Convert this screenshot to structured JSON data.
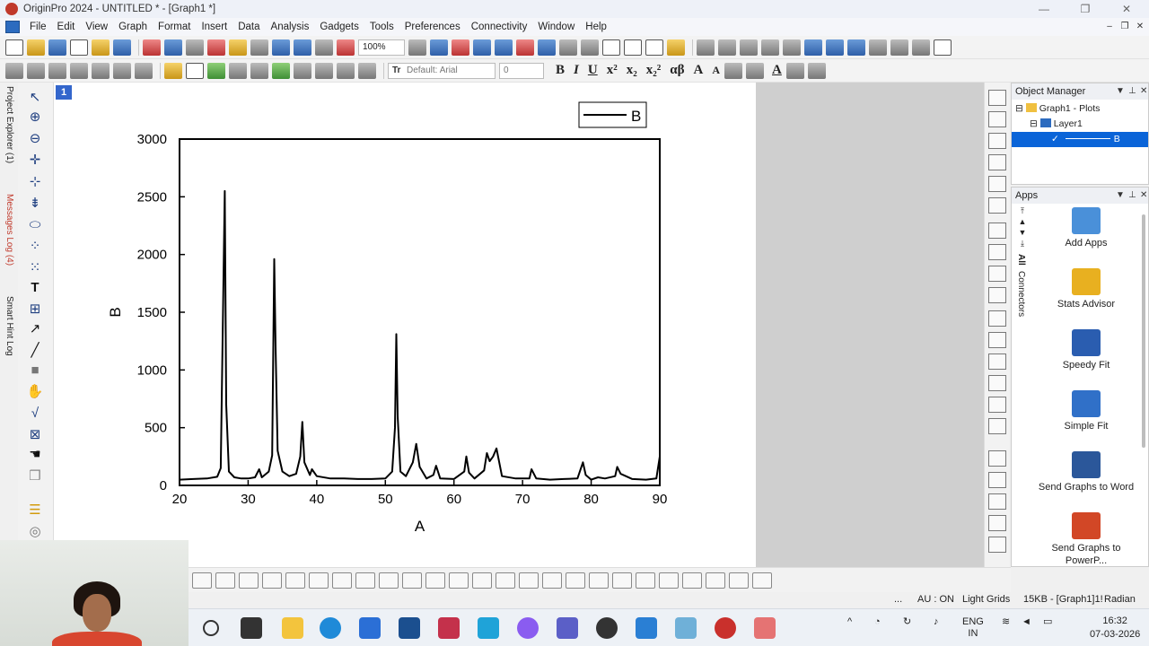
{
  "window": {
    "title": "OriginPro 2024 - UNTITLED * - [Graph1 *]"
  },
  "menu": {
    "items": [
      "File",
      "Edit",
      "View",
      "Graph",
      "Format",
      "Insert",
      "Data",
      "Analysis",
      "Gadgets",
      "Tools",
      "Preferences",
      "Connectivity",
      "Window",
      "Help"
    ]
  },
  "toolbar": {
    "zoom": "100%",
    "font": "Default: Arial",
    "font_size": "0",
    "font_glyph": "Tr"
  },
  "format_buttons": {
    "bold": "B",
    "italic": "I",
    "underline": "U",
    "superscript": "x²",
    "subscript": "x₂",
    "supsub": "x₂²",
    "greek": "αβ",
    "increase_font": "A",
    "decrease_font": "A",
    "font_color": "A"
  },
  "left_tabs": {
    "project_explorer": "Project Explorer (1)",
    "messages_log": "Messages Log (4)",
    "smart_hint": "Smart Hint Log"
  },
  "layer_badge": "1",
  "legend": {
    "label": "B"
  },
  "chart_data": {
    "type": "line",
    "xlabel": "A",
    "ylabel": "B",
    "xlim": [
      20,
      90
    ],
    "ylim": [
      0,
      3000
    ],
    "x_ticks": [
      20,
      30,
      40,
      50,
      60,
      70,
      80,
      90
    ],
    "y_ticks": [
      0,
      500,
      1000,
      1500,
      2000,
      2500,
      3000
    ],
    "series": [
      {
        "name": "B",
        "x": [
          20,
          22,
          24,
          25.5,
          26,
          26.4,
          26.6,
          26.8,
          27.2,
          28,
          29,
          30,
          31,
          31.6,
          32,
          33,
          33.5,
          33.8,
          34.0,
          34.3,
          35,
          36,
          37,
          37.6,
          37.9,
          38.2,
          39,
          39.3,
          40,
          42,
          44,
          46,
          48,
          50,
          51,
          51.4,
          51.6,
          51.8,
          52.2,
          53,
          54,
          54.5,
          55,
          56,
          57,
          57.4,
          58,
          60,
          61.5,
          61.8,
          62.2,
          63,
          64.4,
          64.8,
          65.2,
          65.7,
          66.2,
          67,
          69,
          71,
          71.3,
          72,
          74,
          76,
          78,
          78.8,
          79.2,
          80,
          81,
          82,
          83.5,
          83.8,
          84.3,
          86,
          88,
          89.5,
          90
        ],
        "y": [
          50,
          55,
          60,
          75,
          150,
          1750,
          2550,
          700,
          120,
          70,
          60,
          60,
          70,
          140,
          70,
          120,
          260,
          1960,
          1200,
          300,
          120,
          80,
          100,
          250,
          550,
          200,
          90,
          140,
          80,
          60,
          60,
          55,
          55,
          60,
          120,
          500,
          1310,
          600,
          120,
          80,
          200,
          360,
          160,
          60,
          90,
          170,
          60,
          55,
          120,
          250,
          110,
          60,
          130,
          280,
          210,
          250,
          320,
          80,
          60,
          60,
          140,
          60,
          50,
          55,
          60,
          200,
          90,
          50,
          70,
          60,
          80,
          160,
          100,
          55,
          50,
          60,
          250
        ]
      }
    ]
  },
  "object_manager": {
    "title": "Object Manager",
    "tree": [
      "Graph1 - Plots",
      "Layer1",
      "B"
    ]
  },
  "apps": {
    "title": "Apps",
    "side_tabs": [
      "All",
      "Connectors"
    ],
    "items": [
      {
        "label": "Add Apps",
        "color": "#4a90d9"
      },
      {
        "label": "Stats Advisor",
        "color": "#e8b020"
      },
      {
        "label": "Speedy Fit",
        "color": "#2a5db0"
      },
      {
        "label": "Simple Fit",
        "color": "#3070c8"
      },
      {
        "label": "Send Graphs to Word",
        "color": "#2b579a"
      },
      {
        "label": "Send Graphs to PowerP...",
        "color": "#d24726"
      }
    ]
  },
  "status": {
    "au": "AU : ON",
    "grids": "Light Grids",
    "size": "15KB - [Graph1]1!",
    "angle": "Radian",
    "dots": "..."
  },
  "taskbar": {
    "language": "ENG",
    "region": "IN",
    "time": "16:32",
    "date": "07-03-2026"
  }
}
